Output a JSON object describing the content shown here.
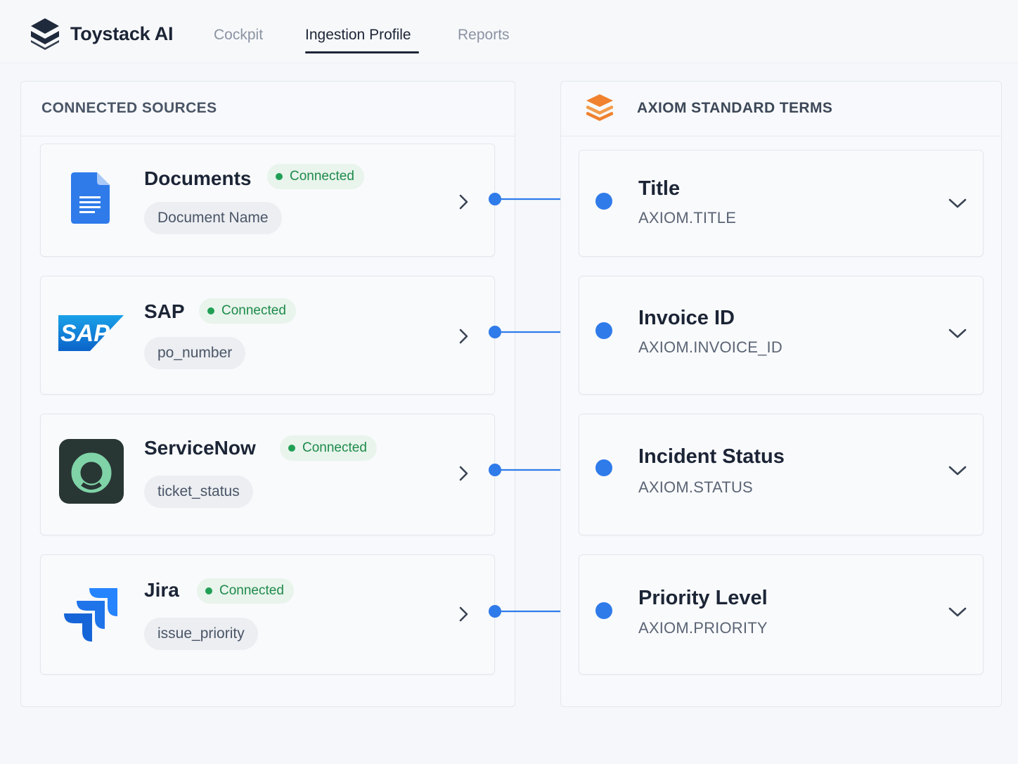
{
  "app": {
    "name": "Toystack AI"
  },
  "nav": {
    "tabs": [
      {
        "label": "Cockpit"
      },
      {
        "label": "Ingestion Profile",
        "active": true
      },
      {
        "label": "Reports"
      }
    ]
  },
  "left_panel": {
    "title": "CONNECTED SOURCES",
    "sources": [
      {
        "name": "Documents",
        "status": "Connected",
        "field": "Document Name",
        "icon": "google-docs-icon"
      },
      {
        "name": "SAP",
        "status": "Connected",
        "field": "po_number",
        "icon": "sap-logo-icon",
        "logo_text": "SAP"
      },
      {
        "name": "ServiceNow",
        "status": "Connected",
        "field": "ticket_status",
        "icon": "servicenow-icon"
      },
      {
        "name": "Jira",
        "status": "Connected",
        "field": "issue_priority",
        "icon": "jira-icon"
      }
    ]
  },
  "right_panel": {
    "title": "AXIOM STANDARD TERMS",
    "icon": "layers-stack-icon",
    "terms": [
      {
        "title": "Title",
        "code": "AXIOM.TITLE"
      },
      {
        "title": "Invoice ID",
        "code": "AXIOM.INVOICE_ID"
      },
      {
        "title": "Incident Status",
        "code": "AXIOM.STATUS"
      },
      {
        "title": "Priority Level",
        "code": "AXIOM.PRIORITY"
      }
    ]
  },
  "colors": {
    "accent_blue": "#2f7bea",
    "connected_green": "#1e8a4a",
    "brand_orange": "#f0812e",
    "text_dark": "#1c2536"
  }
}
